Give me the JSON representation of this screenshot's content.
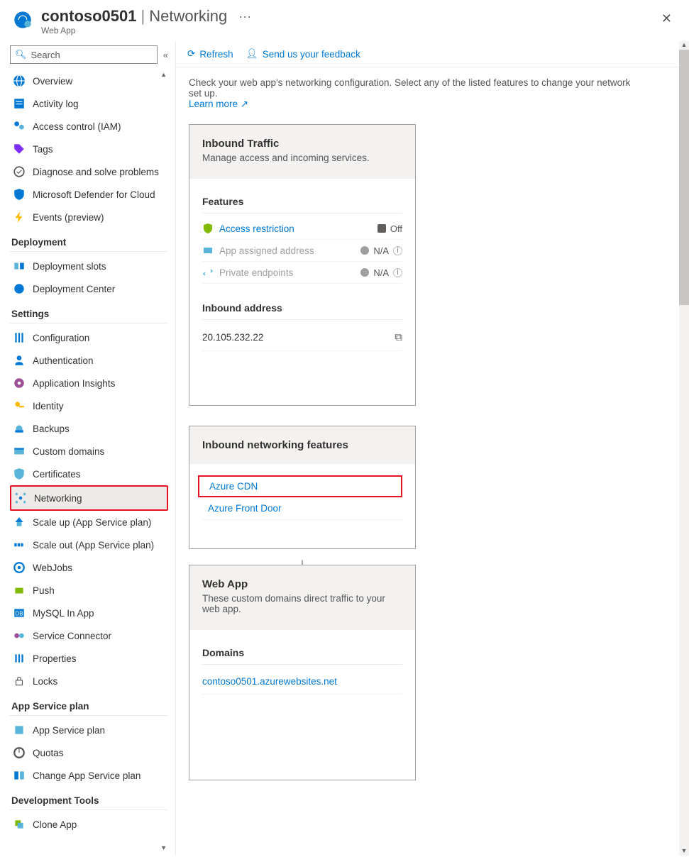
{
  "header": {
    "resource_name": "contoso0501",
    "separator": "|",
    "page": "Networking",
    "subtitle": "Web App",
    "more": "···",
    "close": "✕"
  },
  "search": {
    "placeholder": "Search"
  },
  "nav": {
    "top": [
      {
        "label": "Overview",
        "icon": "globe"
      },
      {
        "label": "Activity log",
        "icon": "log"
      },
      {
        "label": "Access control (IAM)",
        "icon": "iam"
      },
      {
        "label": "Tags",
        "icon": "tag"
      },
      {
        "label": "Diagnose and solve problems",
        "icon": "diag"
      },
      {
        "label": "Microsoft Defender for Cloud",
        "icon": "shield"
      },
      {
        "label": "Events (preview)",
        "icon": "bolt"
      }
    ],
    "groups": [
      {
        "title": "Deployment",
        "items": [
          {
            "label": "Deployment slots",
            "icon": "slots"
          },
          {
            "label": "Deployment Center",
            "icon": "deployc"
          }
        ]
      },
      {
        "title": "Settings",
        "items": [
          {
            "label": "Configuration",
            "icon": "sliders"
          },
          {
            "label": "Authentication",
            "icon": "auth"
          },
          {
            "label": "Application Insights",
            "icon": "insights"
          },
          {
            "label": "Identity",
            "icon": "key"
          },
          {
            "label": "Backups",
            "icon": "backup"
          },
          {
            "label": "Custom domains",
            "icon": "domain"
          },
          {
            "label": "Certificates",
            "icon": "cert"
          },
          {
            "label": "Networking",
            "icon": "network",
            "selected": true,
            "highlight": true
          },
          {
            "label": "Scale up (App Service plan)",
            "icon": "scaleup"
          },
          {
            "label": "Scale out (App Service plan)",
            "icon": "scaleout"
          },
          {
            "label": "WebJobs",
            "icon": "webjobs"
          },
          {
            "label": "Push",
            "icon": "push"
          },
          {
            "label": "MySQL In App",
            "icon": "mysql"
          },
          {
            "label": "Service Connector",
            "icon": "connector"
          },
          {
            "label": "Properties",
            "icon": "props"
          },
          {
            "label": "Locks",
            "icon": "lock"
          }
        ]
      },
      {
        "title": "App Service plan",
        "items": [
          {
            "label": "App Service plan",
            "icon": "plan"
          },
          {
            "label": "Quotas",
            "icon": "quota"
          },
          {
            "label": "Change App Service plan",
            "icon": "change"
          }
        ]
      },
      {
        "title": "Development Tools",
        "items": [
          {
            "label": "Clone App",
            "icon": "clone"
          }
        ]
      }
    ]
  },
  "toolbar": {
    "refresh": "Refresh",
    "feedback": "Send us your feedback"
  },
  "intro": {
    "text": "Check your web app's networking configuration. Select any of the listed features to change your network set up.",
    "learn_more": "Learn more"
  },
  "inbound": {
    "title": "Inbound Traffic",
    "subtitle": "Manage access and incoming services.",
    "features_title": "Features",
    "features": [
      {
        "label": "Access restriction",
        "status": "Off",
        "status_type": "square",
        "enabled": true
      },
      {
        "label": "App assigned address",
        "status": "N/A",
        "status_type": "circle",
        "enabled": false,
        "info": true
      },
      {
        "label": "Private endpoints",
        "status": "N/A",
        "status_type": "circle",
        "enabled": false,
        "info": true
      }
    ],
    "address_title": "Inbound address",
    "address": "20.105.232.22"
  },
  "inbound_features": {
    "title": "Inbound networking features",
    "items": [
      {
        "label": "Azure CDN",
        "highlight": true
      },
      {
        "label": "Azure Front Door"
      }
    ]
  },
  "webapp": {
    "title": "Web App",
    "subtitle": "These custom domains direct traffic to your web app.",
    "domains_title": "Domains",
    "domain": "contoso0501.azurewebsites.net"
  }
}
